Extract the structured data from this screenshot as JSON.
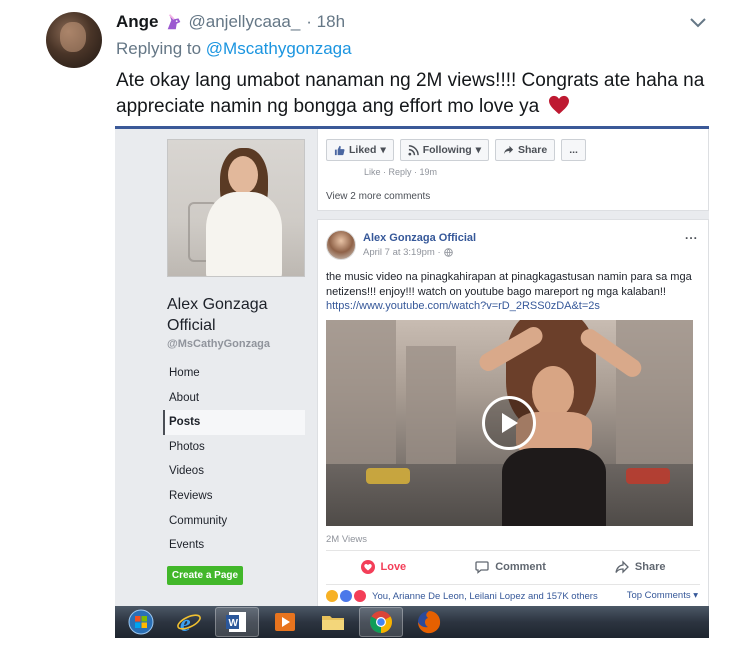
{
  "tweet": {
    "display_name": "Ange",
    "emoji_icon": "unicorn-icon",
    "handle": "@anjellycaaa_",
    "time": "· 18h",
    "replying_prefix": "Replying to",
    "replying_to": "@Mscathygonzaga",
    "text": "Ate okay lang umabot nanaman ng 2M views!!!! Congrats ate haha na appreciate namin ng bongga ang effort mo love ya",
    "heart_icon": "red-heart-icon",
    "colors": {
      "link": "#1b95e0",
      "muted": "#657786",
      "text": "#14171a",
      "heart": "#be1931"
    }
  },
  "facebook": {
    "page_name": "Alex Gonzaga Official",
    "page_handle": "@MsCathyGonzaga",
    "nav": [
      "Home",
      "About",
      "Posts",
      "Photos",
      "Videos",
      "Reviews",
      "Community",
      "Events"
    ],
    "nav_active": "Posts",
    "create_page": "Create a Page",
    "top_actions": {
      "liked": "Liked",
      "following": "Following",
      "share": "Share",
      "more": "..."
    },
    "faded_text": "Like · Reply · 19m",
    "view_more_comments": "View 2 more comments",
    "post": {
      "author": "Alex Gonzaga Official",
      "time": "April 7 at 3:19pm ·",
      "more": "...",
      "text": "the music video na pinagkahirapan at pinagkagastusan namin para sa mga netizens!!! enjoy!!! watch on youtube bago mareport ng mga kalaban!!",
      "link": "https://www.youtube.com/watch?v=rD_2RSS0zDA&t=2s",
      "views": "2M Views",
      "actions": {
        "love": "Love",
        "comment": "Comment",
        "share": "Share"
      },
      "reactions_text": "You, Arianne De Leon, Leilani Lopez and 157K others",
      "top_comments": "Top Comments ▾"
    },
    "colors": {
      "brand": "#3b5998",
      "link": "#365899",
      "love": "#f33e58",
      "create": "#42b72a",
      "bg": "#e9ebee"
    }
  },
  "taskbar": {
    "icons": [
      "windows-start-icon",
      "internet-explorer-icon",
      "word-icon",
      "media-player-icon",
      "file-explorer-icon",
      "chrome-icon",
      "firefox-icon"
    ]
  }
}
